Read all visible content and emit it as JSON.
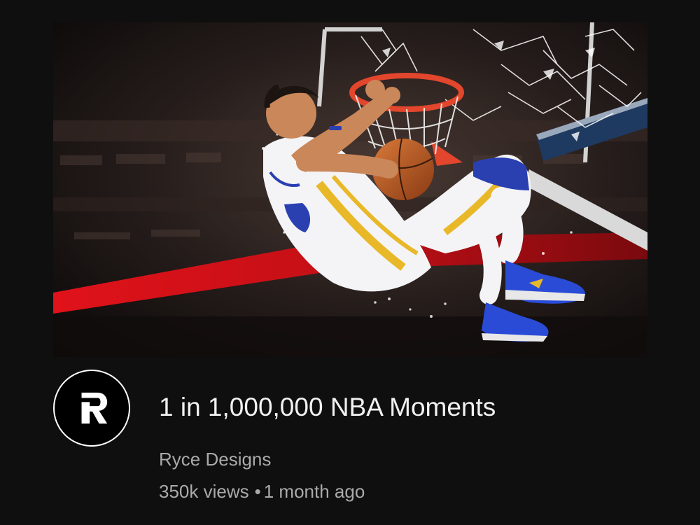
{
  "video": {
    "title": "1 in 1,000,000 NBA Moments",
    "channel": "Ryce Designs",
    "views": "350k views",
    "separator": "•",
    "age": "1 month ago"
  },
  "avatar": {
    "icon": "channel-logo-r-icon"
  },
  "colors": {
    "background": "#0f0f0f",
    "title": "#f1f1f1",
    "secondary_text": "#aaaaaa",
    "jersey_white": "#f4f4f6",
    "jersey_gold": "#e8b828",
    "jersey_blue": "#2a3fb0",
    "rim": "#e2462c",
    "arena_red": "#e0121a"
  }
}
